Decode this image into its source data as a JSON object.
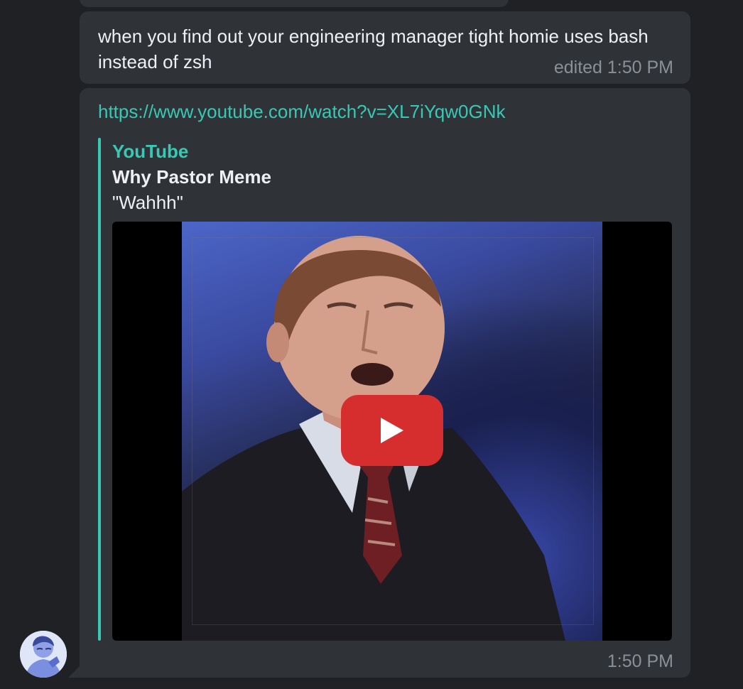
{
  "messages": [
    {
      "text": "when you find out your engineering manager tight homie uses bash instead of zsh",
      "time": "edited 1:50 PM"
    },
    {
      "link": "https://www.youtube.com/watch?v=XL7iYqw0GNk",
      "preview": {
        "site": "YouTube",
        "title": "Why Pastor Meme",
        "description": "\"Wahhh\""
      },
      "time": "1:50 PM"
    }
  ],
  "colors": {
    "background": "#1f2125",
    "bubble": "#2f3338",
    "accent": "#38c8b4",
    "play_button": "#d62e2e",
    "timestamp": "#8b9097"
  },
  "icons": {
    "play": "play-icon"
  }
}
